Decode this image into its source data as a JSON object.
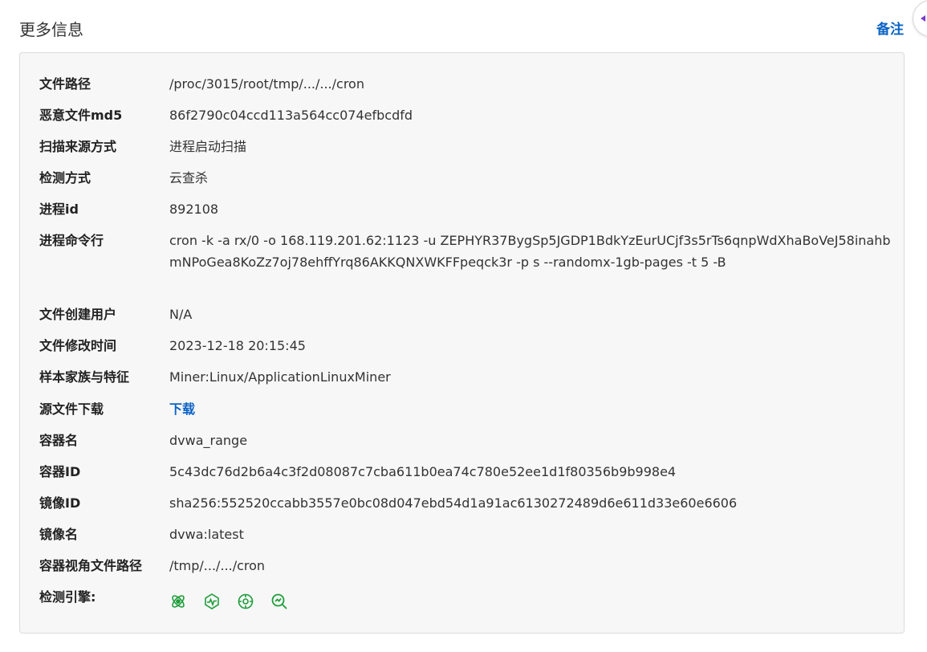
{
  "header": {
    "title": "更多信息",
    "remark_link": "备注"
  },
  "details": [
    {
      "label": "文件路径",
      "value": "/proc/3015/root/tmp/.../.../cron"
    },
    {
      "label": "恶意文件md5",
      "value": "86f2790c04ccd113a564cc074efbcdfd"
    },
    {
      "label": "扫描来源方式",
      "value": "进程启动扫描"
    },
    {
      "label": "检测方式",
      "value": "云查杀"
    },
    {
      "label": "进程id",
      "value": "892108"
    },
    {
      "label": "进程命令行",
      "value": "cron -k -a rx/0 -o 168.119.201.62:1123 -u ZEPHYR37BygSp5JGDP1BdkYzEurUCjf3s5rTs6qnpWdXhaBoVeJ58inahbmNPoGea8KoZz7oj78ehffYrq86AKKQNXWKFFpeqck3r -p s --randomx-1gb-pages -t 5 -B"
    },
    {
      "label": "文件创建用户",
      "value": "N/A"
    },
    {
      "label": "文件修改时间",
      "value": "2023-12-18 20:15:45"
    },
    {
      "label": "样本家族与特征",
      "value": "Miner:Linux/ApplicationLinuxMiner"
    },
    {
      "label": "源文件下载",
      "value": "下载"
    },
    {
      "label": "容器名",
      "value": "dvwa_range"
    },
    {
      "label": "容器ID",
      "value": "5c43dc76d2b6a4c3f2d08087c7cba611b0ea74c780e52ee1d1f80356b9b998e4"
    },
    {
      "label": "镜像ID",
      "value": "sha256:552520ccabb3557e0bc08d047ebd54d1a91ac6130272489d6e611d33e60e6606"
    },
    {
      "label": "镜像名",
      "value": "dvwa:latest"
    },
    {
      "label": "容器视角文件路径",
      "value": "/tmp/.../.../cron"
    },
    {
      "label": "检测引擎:",
      "value": ""
    }
  ],
  "engines": {
    "icons": [
      "atom-engine-icon",
      "pulse-engine-icon",
      "target-engine-icon",
      "search-chart-engine-icon"
    ],
    "color": "#1f9d3a"
  },
  "colors": {
    "link": "#0b63c5",
    "card_bg": "#f7f7f7",
    "card_border": "#dcdcdc"
  }
}
